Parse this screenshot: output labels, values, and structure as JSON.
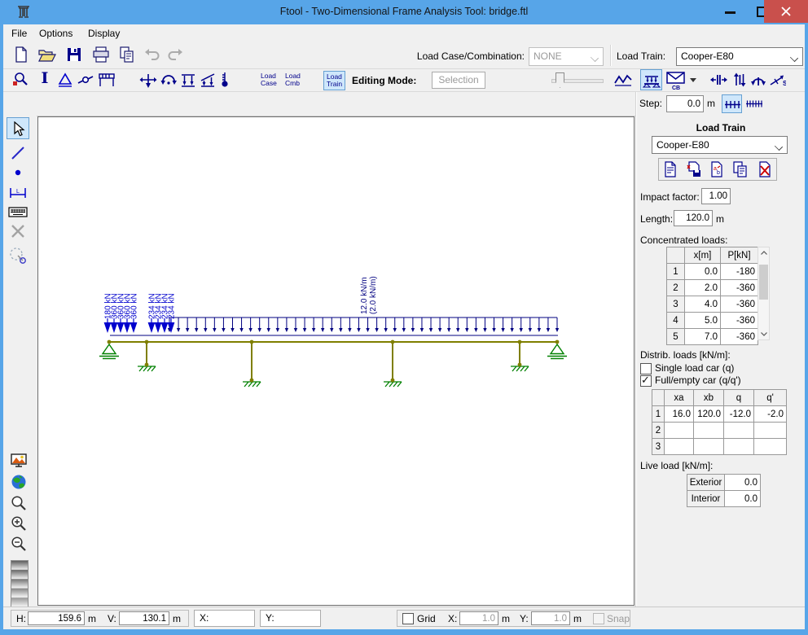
{
  "window": {
    "title": "Ftool - Two-Dimensional Frame Analysis Tool: bridge.ftl"
  },
  "menu": {
    "items": [
      "File",
      "Options",
      "Display"
    ]
  },
  "toolbar": {
    "load_case_combination_label": "Load Case/Combination:",
    "load_case_combination_value": "NONE",
    "load_train_label": "Load Train:",
    "load_train_value": "Cooper-E80",
    "btn_load_case": [
      "Load",
      "Case"
    ],
    "btn_load_cmb": [
      "Load",
      "Cmb"
    ],
    "btn_load_train": [
      "Load",
      "Train"
    ],
    "editing_mode_label": "Editing Mode:",
    "editing_mode_value": "Selection",
    "cb_badge": "CB"
  },
  "step": {
    "label": "Step:",
    "value": "0.0",
    "unit": "m"
  },
  "panel": {
    "title": "Load Train",
    "train_name": "Cooper-E80",
    "impact_label": "Impact factor:",
    "impact_value": "1.00",
    "length_label": "Length:",
    "length_value": "120.0",
    "length_unit": "m",
    "concentrated_label": "Concentrated loads:",
    "conc_table": {
      "headers": [
        "",
        "x[m]",
        "P[kN]"
      ],
      "rows": [
        [
          "1",
          "0.0",
          "-180"
        ],
        [
          "2",
          "2.0",
          "-360"
        ],
        [
          "3",
          "4.0",
          "-360"
        ],
        [
          "4",
          "5.0",
          "-360"
        ],
        [
          "5",
          "7.0",
          "-360"
        ]
      ]
    },
    "distrib_label": "Distrib. loads [kN/m]:",
    "single_car_label": "Single load car (q)",
    "single_car_checked": false,
    "full_car_label": "Full/empty car (q/q')",
    "full_car_checked": true,
    "dist_table": {
      "headers": [
        "",
        "xa",
        "xb",
        "q",
        "q'"
      ],
      "rows": [
        [
          "1",
          "16.0",
          "120.0",
          "-12.0",
          "-2.0"
        ],
        [
          "2",
          "",
          "",
          "",
          ""
        ],
        [
          "3",
          "",
          "",
          "",
          ""
        ]
      ]
    },
    "live_label": "Live load [kN/m]:",
    "live_table": {
      "rows": [
        [
          "Exterior",
          "0.0"
        ],
        [
          "Interior",
          "0.0"
        ]
      ]
    }
  },
  "canvas": {
    "conc_load_labels": [
      "180 kN",
      "360 kN",
      "360 kN",
      "360 kN",
      "360 kN",
      "234 kN",
      "234 kN",
      "234 kN",
      "234 kN"
    ],
    "dist_load_label_1": "12.0 kN/m",
    "dist_load_label_2": "(2.0 kN/m)"
  },
  "status": {
    "h_label": "H:",
    "h_value": "159.6",
    "h_unit": "m",
    "v_label": "V:",
    "v_value": "130.1",
    "v_unit": "m",
    "x_label": "X:",
    "y_label": "Y:",
    "grid_label": "Grid",
    "grid_checked": false,
    "grid_x_label": "X:",
    "grid_x_value": "1.0",
    "grid_x_unit": "m",
    "grid_y_label": "Y:",
    "grid_y_value": "1.0",
    "grid_y_unit": "m",
    "snap_label": "Snap",
    "snap_checked": false
  }
}
